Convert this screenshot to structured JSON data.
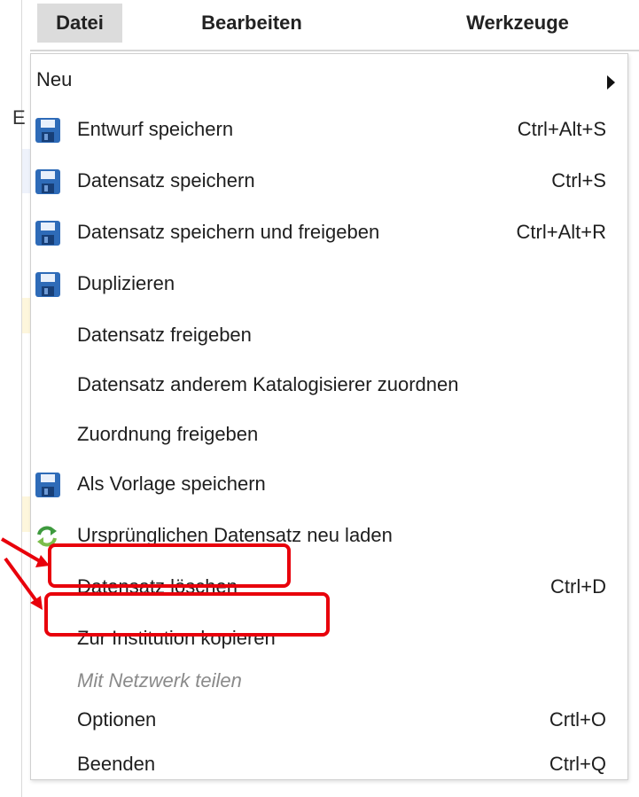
{
  "menubar": {
    "tabs": [
      {
        "label": "Datei",
        "active": true
      },
      {
        "label": "Bearbeiten",
        "active": false
      },
      {
        "label": "Werkzeuge",
        "active": false
      }
    ]
  },
  "background": {
    "partial_letter": "E"
  },
  "menu": {
    "items": [
      {
        "label": "Neu",
        "shortcut": "",
        "icon": "submenu-arrow"
      },
      {
        "label": "Entwurf speichern",
        "shortcut": "Ctrl+Alt+S",
        "icon": "save-icon"
      },
      {
        "label": "Datensatz speichern",
        "shortcut": "Ctrl+S",
        "icon": "save-icon"
      },
      {
        "label": "Datensatz speichern und freigeben",
        "shortcut": "Ctrl+Alt+R",
        "icon": "save-icon"
      },
      {
        "label": "Duplizieren",
        "shortcut": "",
        "icon": "save-icon"
      },
      {
        "label": "Datensatz freigeben",
        "shortcut": "",
        "icon": ""
      },
      {
        "label": "Datensatz anderem Katalogisierer zuordnen",
        "shortcut": "",
        "icon": ""
      },
      {
        "label": "Zuordnung freigeben",
        "shortcut": "",
        "icon": ""
      },
      {
        "label": "Als Vorlage speichern",
        "shortcut": "",
        "icon": "save-icon"
      },
      {
        "label": "Ursprünglichen Datensatz neu laden",
        "shortcut": "",
        "icon": "refresh-icon"
      },
      {
        "label": "Datensatz löschen",
        "shortcut": "Ctrl+D",
        "icon": "",
        "highlighted": true
      },
      {
        "label": "Zur Institution kopieren",
        "shortcut": "",
        "icon": "",
        "highlighted": true
      },
      {
        "label": "Mit Netzwerk teilen",
        "shortcut": "",
        "icon": "",
        "disabled": true
      },
      {
        "label": "Optionen",
        "shortcut": "Crtl+O",
        "icon": ""
      },
      {
        "label": "Beenden",
        "shortcut": "Ctrl+Q",
        "icon": ""
      }
    ]
  },
  "colors": {
    "highlight": "#e8000b",
    "save_icon_blue": "#2e6bb8",
    "refresh_green": "#3e9a3e",
    "active_tab_bg": "#dcdcdc"
  }
}
